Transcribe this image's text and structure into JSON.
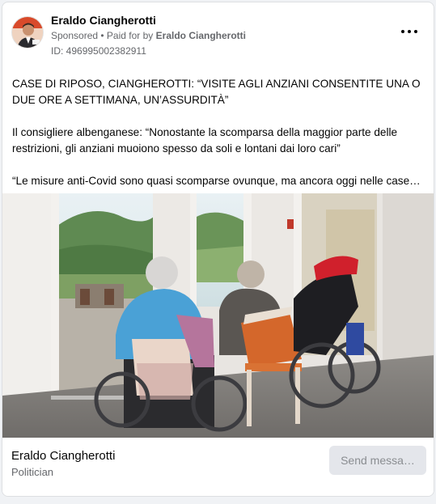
{
  "post": {
    "author": "Eraldo Ciangherotti",
    "sponsored_label": "Sponsored",
    "paid_for_prefix": "• Paid for by",
    "paid_for_by": "Eraldo Ciangherotti",
    "ad_id": "ID: 496995002382911",
    "paragraphs": [
      "CASE DI RIPOSO, CIANGHEROTTI: “VISITE AGLI ANZIANI CONSENTITE UNA O DUE ORE A SETTIMANA, UN’ASSURDITÀ”",
      "Il consigliere albenganese: “Nonostante la scomparsa della maggior parte delle restrizioni, gli anziani muoiono spesso da soli e lontani dai loro cari”",
      "“Le misure anti-Covid sono quasi scomparse ovunque, ma ancora oggi nelle case…"
    ]
  },
  "footer": {
    "page_name": "Eraldo Ciangherotti",
    "category": "Politician",
    "button_label": "Send messa…"
  },
  "icons": {
    "more": "more-options-icon",
    "avatar": "profile-photo"
  },
  "colors": {
    "text_primary": "#050505",
    "text_secondary": "#65676b",
    "button_bg": "#e4e6eb",
    "button_text": "#8a8d91"
  }
}
